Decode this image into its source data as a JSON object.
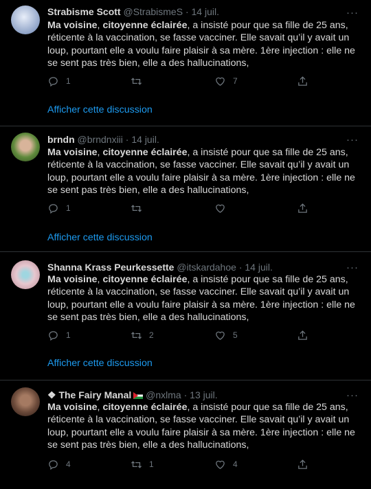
{
  "tweets": [
    {
      "name": "Strabisme Scott",
      "handle": "@StrabismeS",
      "date": "14 juil.",
      "flag": false,
      "text_bold1": "Ma voisine",
      "text_sep": ", ",
      "text_bold2": "citoyenne éclairée",
      "text_rest": ", a insisté pour que sa fille de 25 ans, réticente à la vaccination, se fasse vacciner. Elle savait qu’il y avait un loup, pourtant elle a voulu faire plaisir à sa mère. 1ère injection : elle ne se sent pas très bien, elle a des hallucinations,",
      "replies": "1",
      "retweets": "",
      "likes": "7",
      "show_thread": "Afficher cette discussion",
      "avatar_colors": [
        "#c9d3e8",
        "#8fa3c7"
      ]
    },
    {
      "name": "brndn",
      "handle": "@brndnxiii",
      "date": "14 juil.",
      "flag": false,
      "text_bold1": "Ma voisine",
      "text_sep": ", ",
      "text_bold2": "citoyenne éclairée",
      "text_rest": ", a insisté pour que sa fille de 25 ans, réticente à la vaccination, se fasse vacciner. Elle savait qu’il y avait un loup, pourtant elle a voulu faire plaisir à sa mère. 1ère injection : elle ne se sent pas très bien, elle a des hallucinations,",
      "replies": "1",
      "retweets": "",
      "likes": "",
      "show_thread": "Afficher cette discussion",
      "avatar_colors": [
        "#5f8a3c",
        "#2e4a1e"
      ]
    },
    {
      "name": "Shanna Krass Peurkessette",
      "handle": "@itskardahoe",
      "date": "14 juil.",
      "flag": false,
      "text_bold1": "Ma voisine",
      "text_sep": ", ",
      "text_bold2": "citoyenne éclairée",
      "text_rest": ", a insisté pour que sa fille de 25 ans, réticente à la vaccination, se fasse vacciner. Elle savait qu’il y avait un loup, pourtant elle a voulu faire plaisir à sa mère. 1ère injection : elle ne se sent pas très bien, elle a des hallucinations,",
      "replies": "1",
      "retweets": "2",
      "likes": "5",
      "show_thread": "Afficher cette discussion",
      "avatar_colors": [
        "#e6c7cf",
        "#b98a95"
      ]
    },
    {
      "name": "❖ The Fairy Manal",
      "handle": "@nxlma",
      "date": "13 juil.",
      "flag": true,
      "text_bold1": "Ma voisine",
      "text_sep": ", ",
      "text_bold2": "citoyenne éclairée",
      "text_rest": ", a insisté pour que sa fille de 25 ans, réticente à la vaccination, se fasse vacciner. Elle savait qu’il y avait un loup, pourtant elle a voulu faire plaisir à sa mère. 1ère injection : elle ne se sent pas très bien, elle a des hallucinations,",
      "replies": "4",
      "retweets": "1",
      "likes": "4",
      "show_thread": "",
      "avatar_colors": [
        "#6b4a3a",
        "#2a1a14"
      ]
    }
  ],
  "icons": {
    "reply": "reply-icon",
    "retweet": "retweet-icon",
    "like": "heart-icon",
    "share": "share-icon",
    "more": "more-icon"
  }
}
